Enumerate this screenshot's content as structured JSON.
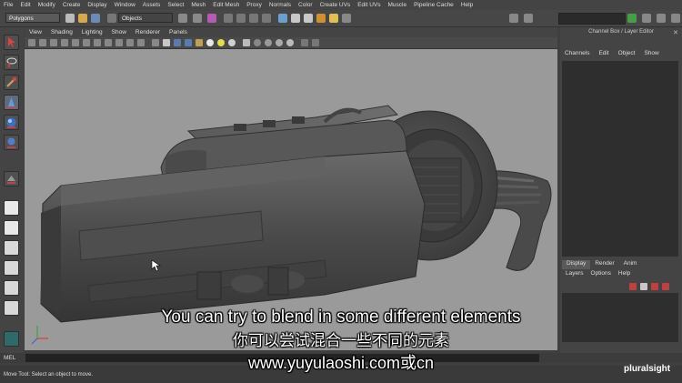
{
  "menubar": [
    "File",
    "Edit",
    "Modify",
    "Create",
    "Display",
    "Window",
    "Assets",
    "Select",
    "Mesh",
    "Edit Mesh",
    "Proxy",
    "Normals",
    "Color",
    "Create UVs",
    "Edit UVs",
    "Muscle",
    "Pipeline Cache",
    "Help"
  ],
  "shelf": {
    "mode_select": "Polygons",
    "objects_field": "Objects"
  },
  "panel_menu": [
    "View",
    "Shading",
    "Lighting",
    "Show",
    "Renderer",
    "Panels"
  ],
  "channel_box": {
    "title": "Channel Box / Layer Editor",
    "menu": [
      "Channels",
      "Edit",
      "Object",
      "Show"
    ]
  },
  "layer_editor": {
    "tabs": [
      "Display",
      "Render",
      "Anim"
    ],
    "active_tab": "Display",
    "menu": [
      "Layers",
      "Options",
      "Help"
    ]
  },
  "command_line": {
    "label": "MEL"
  },
  "help_line": "Move Tool: Select an object to move.",
  "subtitles": {
    "english": "You can try to blend in some different elements",
    "chinese": "你可以尝试混合一些不同的元素",
    "url": "www.yuyulaoshi.com或cn"
  },
  "watermark": "pluralsight",
  "colors": {
    "viewport_bg": "#9a9a9a",
    "ui_bg": "#444444",
    "accent_green": "#3fa33f",
    "tool_red": "#c0392b"
  },
  "icons": [
    "select-tool-icon",
    "lasso-tool-icon",
    "paint-select-icon",
    "move-tool-icon",
    "rotate-tool-icon",
    "scale-tool-icon",
    "cursor-icon",
    "axis-gizmo-icon"
  ]
}
